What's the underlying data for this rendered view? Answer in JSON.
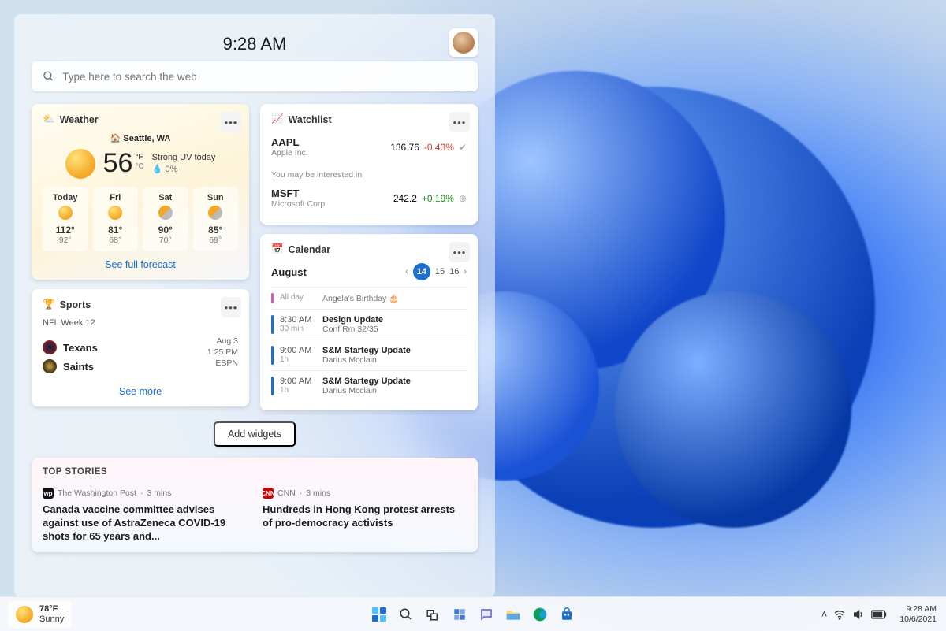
{
  "panel": {
    "time": "9:28 AM"
  },
  "search": {
    "placeholder": "Type here to search the web"
  },
  "weather": {
    "title": "Weather",
    "location": "Seattle, WA",
    "temp": "56",
    "unit_f": "°F",
    "unit_c": "°C",
    "uv": "Strong UV today",
    "precip": "0%",
    "forecast": [
      {
        "day": "Today",
        "hi": "112°",
        "lo": "92°"
      },
      {
        "day": "Fri",
        "hi": "81°",
        "lo": "68°"
      },
      {
        "day": "Sat",
        "hi": "90°",
        "lo": "70°"
      },
      {
        "day": "Sun",
        "hi": "85°",
        "lo": "69°"
      }
    ],
    "link": "See full forecast"
  },
  "sports": {
    "title": "Sports",
    "week": "NFL Week 12",
    "teams": [
      "Texans",
      "Saints"
    ],
    "date": "Aug 3",
    "time": "1:25 PM",
    "net": "ESPN",
    "link": "See more"
  },
  "watch": {
    "title": "Watchlist",
    "interest": "You may be interested in",
    "rows": [
      {
        "ticker": "AAPL",
        "company": "Apple Inc.",
        "price": "136.76",
        "change": "-0.43%",
        "dir": "neg"
      },
      {
        "ticker": "MSFT",
        "company": "Microsoft Corp.",
        "price": "242.2",
        "change": "+0.19%",
        "dir": "pos"
      }
    ]
  },
  "calendar": {
    "title": "Calendar",
    "month": "August",
    "days": [
      "14",
      "15",
      "16"
    ],
    "events": [
      {
        "bar": "p",
        "t1": "All day",
        "t2": "",
        "e1": "Angela's Birthday",
        "e2": ""
      },
      {
        "bar": "b",
        "t1": "8:30 AM",
        "t2": "30 min",
        "e1": "Design Update",
        "e2": "Conf Rm 32/35"
      },
      {
        "bar": "b",
        "t1": "9:00 AM",
        "t2": "1h",
        "e1": "S&M Startegy Update",
        "e2": "Darius Mcclain"
      },
      {
        "bar": "b",
        "t1": "9:00 AM",
        "t2": "1h",
        "e1": "S&M Startegy Update",
        "e2": "Darius Mcclain"
      }
    ]
  },
  "add_widgets": "Add widgets",
  "news": {
    "title": "TOP STORIES",
    "items": [
      {
        "src": "The Washington Post",
        "age": "3 mins",
        "icon": "wp",
        "icon_label": "WP",
        "headline": "Canada vaccine committee advises against use of AstraZeneca COVID-19 shots for 65 years and..."
      },
      {
        "src": "CNN",
        "age": "3 mins",
        "icon": "cnn",
        "icon_label": "CNN",
        "headline": "Hundreds in Hong Kong protest arrests of pro-democracy activists"
      }
    ]
  },
  "taskbar": {
    "weather_temp": "78°F",
    "weather_cond": "Sunny",
    "time": "9:28 AM",
    "date": "10/6/2021"
  }
}
